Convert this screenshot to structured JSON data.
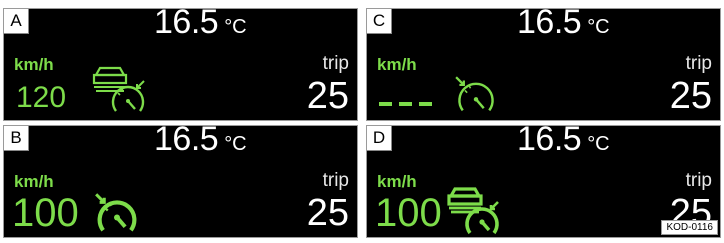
{
  "colors": {
    "green": "#7ddc4a",
    "white": "#ffffff",
    "background": "#000000"
  },
  "panels": {
    "A": {
      "label": "A",
      "temp_value": "16.5",
      "temp_unit": "°C",
      "speed_unit": "km/h",
      "speed_value": "120",
      "trip_label": "trip",
      "trip_value": "25",
      "icons": [
        "car-ahead-icon",
        "speedometer-set-icon"
      ]
    },
    "C": {
      "label": "C",
      "temp_value": "16.5",
      "temp_unit": "°C",
      "speed_unit": "km/h",
      "speed_value": "---",
      "trip_label": "trip",
      "trip_value": "25",
      "icons": [
        "speedometer-set-icon"
      ]
    },
    "B": {
      "label": "B",
      "temp_value": "16.5",
      "temp_unit": "°C",
      "speed_unit": "km/h",
      "speed_value": "100",
      "trip_label": "trip",
      "trip_value": "25",
      "icons": [
        "speedometer-active-icon"
      ]
    },
    "D": {
      "label": "D",
      "temp_value": "16.5",
      "temp_unit": "°C",
      "speed_unit": "km/h",
      "speed_value": "100",
      "trip_label": "trip",
      "trip_value": "25",
      "icons": [
        "car-ahead-icon",
        "speedometer-active-icon"
      ]
    }
  },
  "figure_code": "KOD-0116"
}
